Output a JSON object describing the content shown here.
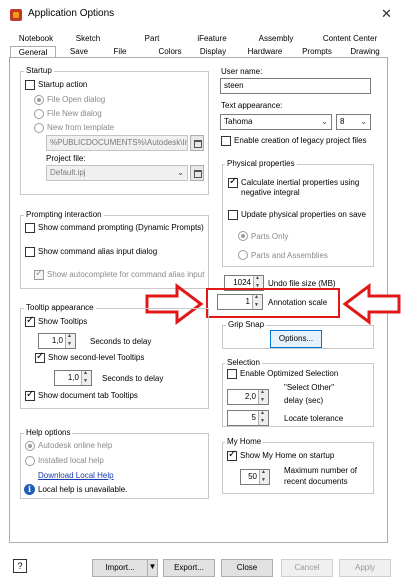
{
  "window": {
    "title": "Application Options"
  },
  "tabs_row1": [
    "Notebook",
    "Sketch",
    "Part",
    "iFeature",
    "Assembly",
    "Content Center"
  ],
  "tabs_row2": [
    "General",
    "Save",
    "File",
    "Colors",
    "Display",
    "Hardware",
    "Prompts",
    "Drawing"
  ],
  "active_tab": "General",
  "startup": {
    "group": "Startup",
    "startup_action": "Startup action",
    "file_open_dialog": "File Open dialog",
    "file_new_dialog": "File New dialog",
    "new_from_template": "New from template",
    "template_path": "%PUBLICDOCUMENTS%\\Autodesk\\Im",
    "project_file_label": "Project file:",
    "project_file_value": "Default.ipj"
  },
  "user_name": {
    "label": "User name:",
    "value": "steen"
  },
  "text_appearance": {
    "label": "Text appearance:",
    "font": "Tahoma",
    "size": "8",
    "legacy": "Enable creation of legacy project files"
  },
  "physical": {
    "group": "Physical properties",
    "calc_inertial": "Calculate inertial properties using negative integral",
    "update_on_save": "Update physical properties on save",
    "parts_only": "Parts Only",
    "parts_assemblies": "Parts and Assemblies"
  },
  "prompting": {
    "group": "Prompting interaction",
    "show_prompting": "Show command prompting (Dynamic Prompts)",
    "show_alias": "Show command alias input dialog",
    "show_autocomplete": "Show autocomplete for command alias input"
  },
  "undo": {
    "value": "1024",
    "label": "Undo file size (MB)"
  },
  "annotation": {
    "value": "1",
    "label": "Annotation scale"
  },
  "grip_snap": {
    "label": "Grip Snap",
    "options_button": "Options..."
  },
  "tooltip": {
    "group": "Tooltip appearance",
    "show_tooltips": "Show Tooltips",
    "delay1_value": "1,0",
    "delay1_label": "Seconds to delay",
    "show_second": "Show second-level Tooltips",
    "delay2_value": "1,0",
    "delay2_label": "Seconds to delay",
    "show_doc_tab": "Show document tab Tooltips"
  },
  "selection": {
    "group": "Selection",
    "enable_optimized": "Enable Optimized Selection",
    "select_other_value": "2,0",
    "select_other_label1": "\"Select Other\"",
    "select_other_label2": "delay (sec)",
    "locate_value": "5",
    "locate_label": "Locate tolerance"
  },
  "help": {
    "group": "Help options",
    "online": "Autodesk online help",
    "installed": "Installed local help",
    "download": "Download Local Help",
    "unavailable": "Local help is unavailable."
  },
  "myhome": {
    "group": "My Home",
    "show_startup": "Show My Home on startup",
    "max_value": "50",
    "max_label1": "Maximum number of",
    "max_label2": "recent documents"
  },
  "footer": {
    "help": "?",
    "import": "Import...",
    "export": "Export...",
    "close": "Close",
    "cancel": "Cancel",
    "apply": "Apply"
  },
  "colors": {
    "highlight": "#e01818",
    "accent": "#0078d7",
    "link": "#1a3cb0"
  }
}
